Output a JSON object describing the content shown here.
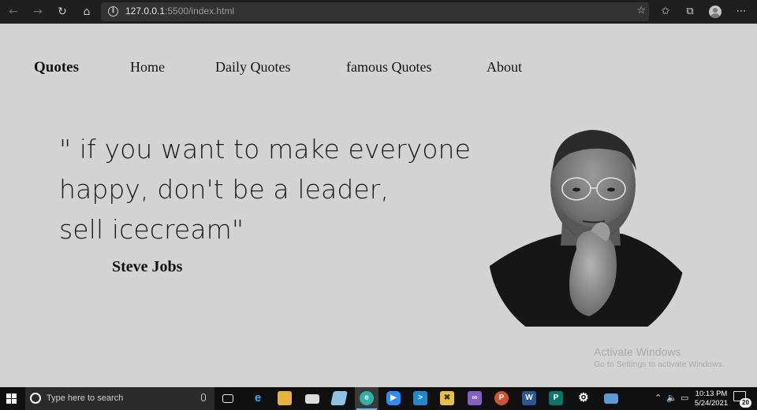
{
  "browser": {
    "url_host": "127.0.0.1",
    "url_rest": ":5500/index.html",
    "icons": [
      "back-icon",
      "forward-icon",
      "refresh-icon",
      "home-icon",
      "site-info-icon",
      "add-favorite-icon",
      "favorites-icon",
      "collections-icon",
      "profile-icon",
      "more-icon"
    ]
  },
  "nav": {
    "brand": "Quotes",
    "items": [
      {
        "label": "Home"
      },
      {
        "label": "Daily Quotes"
      },
      {
        "label": "famous Quotes"
      },
      {
        "label": "About"
      }
    ]
  },
  "quote": {
    "lines": [
      "\" if you want to make everyone",
      "happy, don't be a leader,",
      "sell icecream\""
    ],
    "author": "Steve Jobs"
  },
  "watermark": {
    "title": "Activate Windows",
    "subtitle": "Go to Settings to activate Windows."
  },
  "taskbar": {
    "search_placeholder": "Type here to search",
    "time": "10:13 PM",
    "date": "5/24/2021",
    "notification_count": "20",
    "apps": [
      "task-view",
      "edge",
      "file-explorer",
      "mail",
      "notepad",
      "edge-dev",
      "zoom",
      "vscode",
      "paint",
      "visual-studio",
      "powerpoint",
      "word",
      "publisher",
      "settings",
      "remote-desktop"
    ]
  },
  "colors": {
    "page_bg": "#d3d3d3",
    "chrome_bg": "#1f1f1f",
    "taskbar_bg": "#101010",
    "accent": "#76b9ed"
  }
}
